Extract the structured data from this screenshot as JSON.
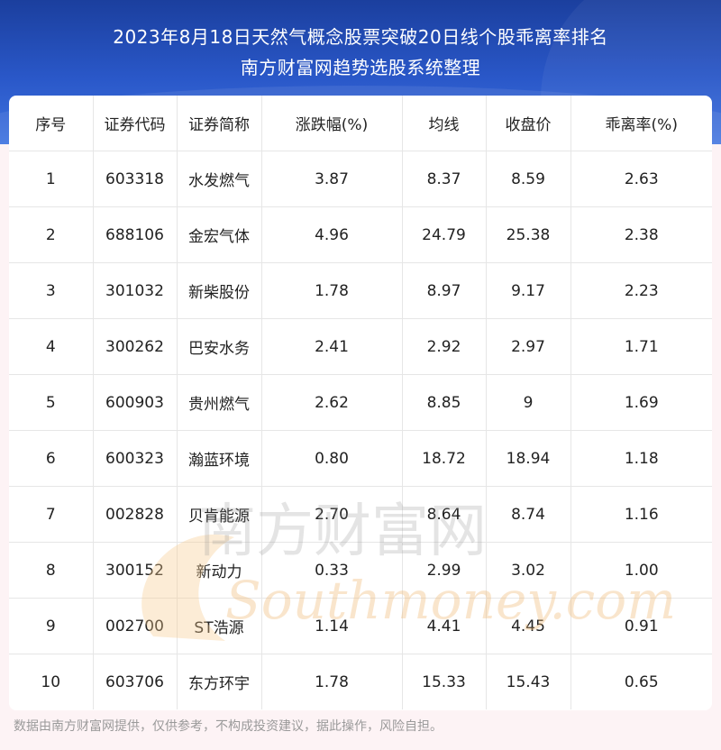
{
  "header": {
    "title_line1": "2023年8月18日天然气概念股票突破20日线个股乖离率排名",
    "title_line2": "南方财富网趋势选股系统整理"
  },
  "table": {
    "columns": [
      "序号",
      "证券代码",
      "证券简称",
      "涨跌幅(%)",
      "均线",
      "收盘价",
      "乖离率(%)"
    ],
    "rows": [
      [
        "1",
        "603318",
        "水发燃气",
        "3.87",
        "8.37",
        "8.59",
        "2.63"
      ],
      [
        "2",
        "688106",
        "金宏气体",
        "4.96",
        "24.79",
        "25.38",
        "2.38"
      ],
      [
        "3",
        "301032",
        "新柴股份",
        "1.78",
        "8.97",
        "9.17",
        "2.23"
      ],
      [
        "4",
        "300262",
        "巴安水务",
        "2.41",
        "2.92",
        "2.97",
        "1.71"
      ],
      [
        "5",
        "600903",
        "贵州燃气",
        "2.62",
        "8.85",
        "9",
        "1.69"
      ],
      [
        "6",
        "600323",
        "瀚蓝环境",
        "0.80",
        "18.72",
        "18.94",
        "1.18"
      ],
      [
        "7",
        "002828",
        "贝肯能源",
        "2.70",
        "8.64",
        "8.74",
        "1.16"
      ],
      [
        "8",
        "300152",
        "新动力",
        "0.33",
        "2.99",
        "3.02",
        "1.00"
      ],
      [
        "9",
        "002700",
        "ST浩源",
        "1.14",
        "4.41",
        "4.45",
        "0.91"
      ],
      [
        "10",
        "603706",
        "东方环宇",
        "1.78",
        "15.33",
        "15.43",
        "0.65"
      ]
    ]
  },
  "watermark": {
    "cn": "南方财富网",
    "en": "Southmoney.com"
  },
  "footer": {
    "disclaimer": "数据由南方财富网提供，仅供参考，不构成投资建议，据此操作，风险自担。"
  },
  "colors": {
    "header_blue": "#2a58c9",
    "page_bg": "#fdf3f5",
    "text": "#222222",
    "footer_text": "#9a9a9a"
  }
}
